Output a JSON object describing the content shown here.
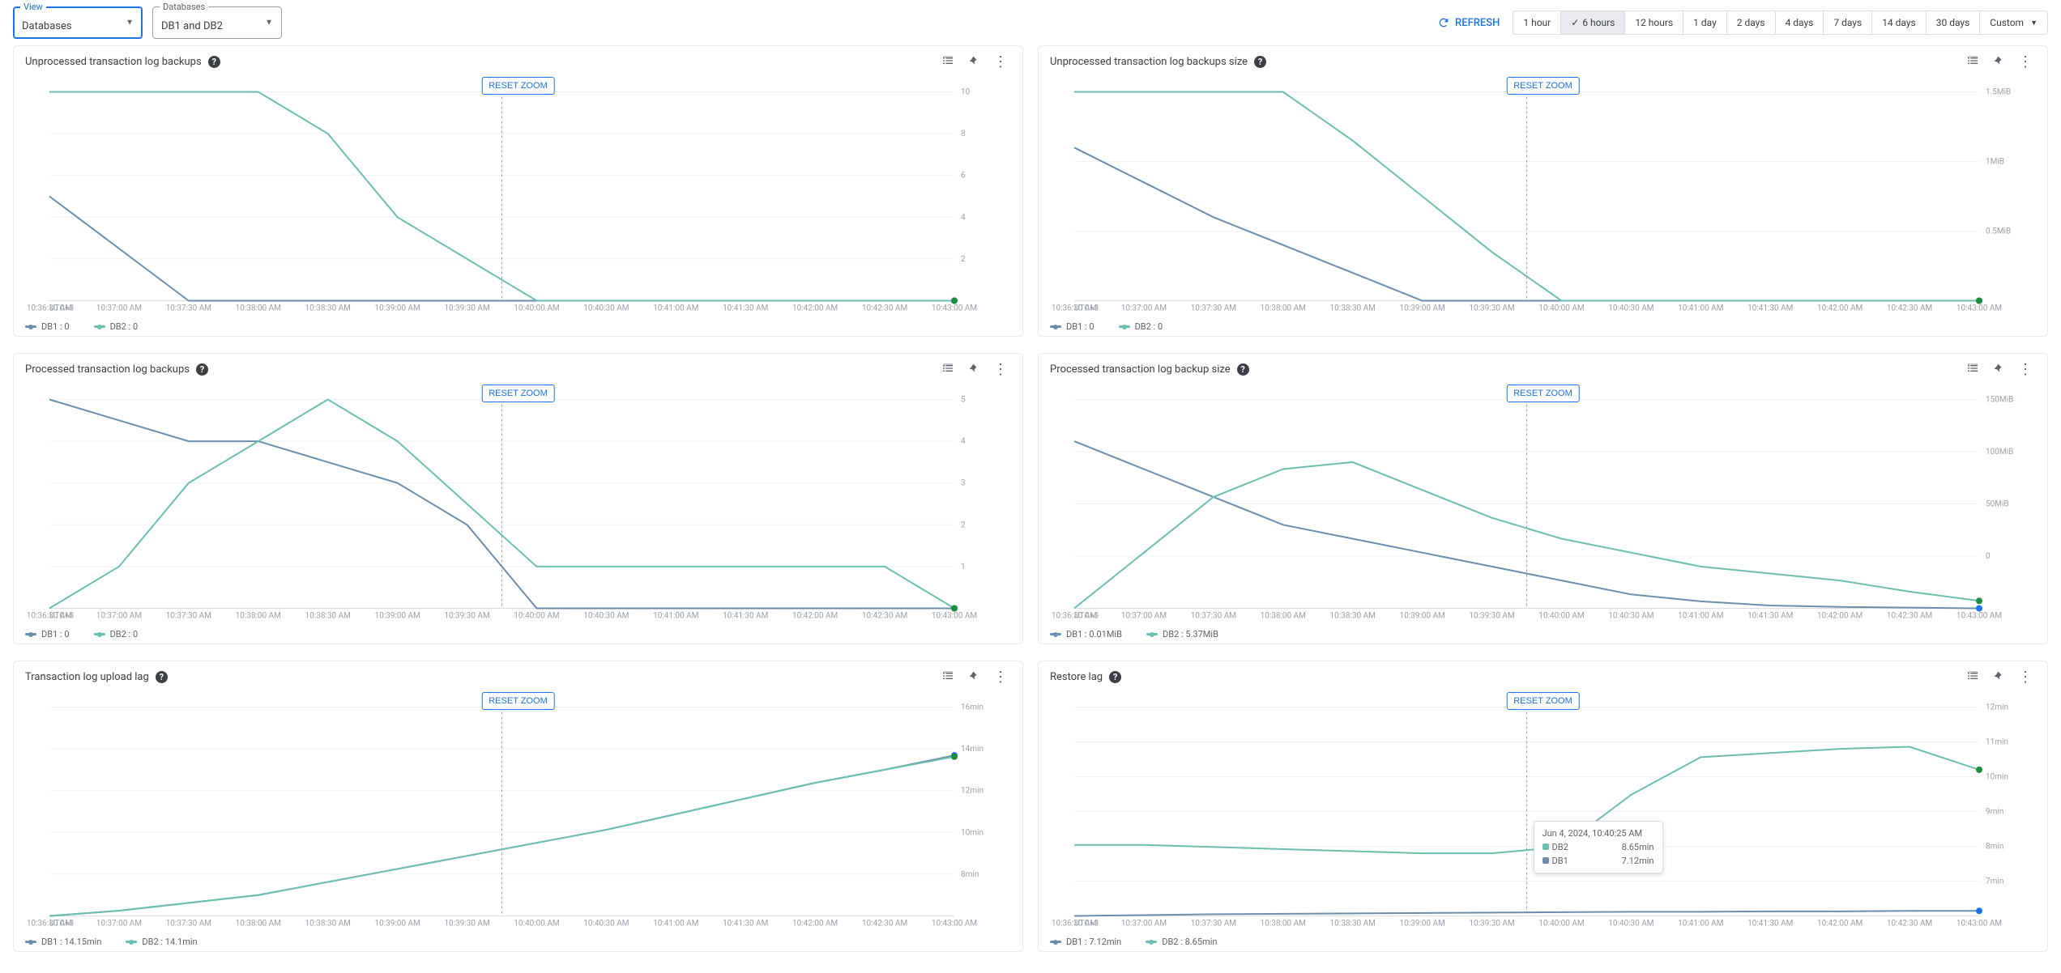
{
  "view_selector": {
    "label": "View",
    "value": "Databases"
  },
  "db_selector": {
    "label": "Databases",
    "value": "DB1 and DB2"
  },
  "refresh_label": "REFRESH",
  "time_ranges": [
    "1 hour",
    "6 hours",
    "12 hours",
    "1 day",
    "2 days",
    "4 days",
    "7 days",
    "14 days",
    "30 days",
    "Custom"
  ],
  "time_range_selected": "6 hours",
  "reset_zoom_label": "RESET ZOOM",
  "x_tick_tz": "UTC+3",
  "x_ticks": [
    "10:36:30 AM",
    "10:37:00 AM",
    "10:37:30 AM",
    "10:38:00 AM",
    "10:38:30 AM",
    "10:39:00 AM",
    "10:39:30 AM",
    "10:40:00 AM",
    "10:40:30 AM",
    "10:41:00 AM",
    "10:41:30 AM",
    "10:42:00 AM",
    "10:42:30 AM",
    "10:43:00 AM"
  ],
  "cards": [
    {
      "title": "Unprocessed transaction log backups",
      "legend": [
        {
          "name": "DB1",
          "value": "0"
        },
        {
          "name": "DB2",
          "value": "0"
        }
      ],
      "y_labels": [
        "10",
        "8",
        "6",
        "4",
        "2"
      ]
    },
    {
      "title": "Unprocessed transaction log backups size",
      "legend": [
        {
          "name": "DB1",
          "value": "0"
        },
        {
          "name": "DB2",
          "value": "0"
        }
      ],
      "y_labels": [
        "1.5MiB",
        "1MiB",
        "0.5MiB"
      ]
    },
    {
      "title": "Processed transaction log backups",
      "legend": [
        {
          "name": "DB1",
          "value": "0"
        },
        {
          "name": "DB2",
          "value": "0"
        }
      ],
      "y_labels": [
        "5",
        "4",
        "3",
        "2",
        "1"
      ]
    },
    {
      "title": "Processed transaction log backup size",
      "legend": [
        {
          "name": "DB1",
          "value": "0.01MiB"
        },
        {
          "name": "DB2",
          "value": "5.37MiB"
        }
      ],
      "y_labels": [
        "150MiB",
        "100MiB",
        "50MiB",
        "0"
      ]
    },
    {
      "title": "Transaction log upload lag",
      "legend": [
        {
          "name": "DB1",
          "value": "14.15min"
        },
        {
          "name": "DB2",
          "value": "14.1min"
        }
      ],
      "y_labels": [
        "16min",
        "14min",
        "12min",
        "10min",
        "8min"
      ]
    },
    {
      "title": "Restore lag",
      "legend": [
        {
          "name": "DB1",
          "value": "7.12min"
        },
        {
          "name": "DB2",
          "value": "8.65min"
        }
      ],
      "y_labels": [
        "12min",
        "11min",
        "10min",
        "9min",
        "8min",
        "7min"
      ]
    }
  ],
  "tooltip": {
    "timestamp": "Jun 4, 2024, 10:40:25 AM",
    "rows": [
      {
        "series": "DB2",
        "value": "8.65min"
      },
      {
        "series": "DB1",
        "value": "7.12min"
      }
    ]
  },
  "chart_data": [
    {
      "title": "Unprocessed transaction log backups",
      "type": "line",
      "x": [
        "10:36:30",
        "10:37:00",
        "10:37:30",
        "10:38:00",
        "10:38:30",
        "10:39:00",
        "10:39:30",
        "10:40:00",
        "10:40:30",
        "10:41:00",
        "10:41:30",
        "10:42:00",
        "10:42:30",
        "10:43:00"
      ],
      "series": [
        {
          "name": "DB1",
          "values": [
            5,
            2.5,
            0,
            0,
            0,
            0,
            0,
            0,
            0,
            0,
            0,
            0,
            0,
            0
          ]
        },
        {
          "name": "DB2",
          "values": [
            10,
            10,
            10,
            10,
            8,
            4,
            2,
            0,
            0,
            0,
            0,
            0,
            0,
            0
          ]
        }
      ],
      "ylim": [
        0,
        10
      ],
      "xlabel": "UTC+3",
      "ylabel": ""
    },
    {
      "title": "Unprocessed transaction log backups size",
      "type": "line",
      "x": [
        "10:36:30",
        "10:37:00",
        "10:37:30",
        "10:38:00",
        "10:38:30",
        "10:39:00",
        "10:39:30",
        "10:40:00",
        "10:40:30",
        "10:41:00",
        "10:41:30",
        "10:42:00",
        "10:42:30",
        "10:43:00"
      ],
      "series": [
        {
          "name": "DB1",
          "values": [
            1.1,
            0.85,
            0.6,
            0.4,
            0.2,
            0,
            0,
            0,
            0,
            0,
            0,
            0,
            0,
            0
          ]
        },
        {
          "name": "DB2",
          "values": [
            1.5,
            1.5,
            1.5,
            1.5,
            1.15,
            0.75,
            0.35,
            0,
            0,
            0,
            0,
            0,
            0,
            0
          ]
        }
      ],
      "ylim": [
        0,
        1.5
      ],
      "xlabel": "UTC+3",
      "ylabel": "MiB"
    },
    {
      "title": "Processed transaction log backups",
      "type": "line",
      "x": [
        "10:36:30",
        "10:37:00",
        "10:37:30",
        "10:38:00",
        "10:38:30",
        "10:39:00",
        "10:39:30",
        "10:40:00",
        "10:40:30",
        "10:41:00",
        "10:41:30",
        "10:42:00",
        "10:42:30",
        "10:43:00"
      ],
      "series": [
        {
          "name": "DB1",
          "values": [
            5,
            4.5,
            4,
            4,
            3.5,
            3,
            2,
            0,
            0,
            0,
            0,
            0,
            0,
            0
          ]
        },
        {
          "name": "DB2",
          "values": [
            0,
            1,
            3,
            4,
            5,
            4,
            2.5,
            1,
            1,
            1,
            1,
            1,
            1,
            0
          ]
        }
      ],
      "ylim": [
        0,
        5
      ],
      "xlabel": "UTC+3",
      "ylabel": ""
    },
    {
      "title": "Processed transaction log backup size",
      "type": "line",
      "x": [
        "10:36:30",
        "10:37:00",
        "10:37:30",
        "10:38:00",
        "10:38:30",
        "10:39:00",
        "10:39:30",
        "10:40:00",
        "10:40:30",
        "10:41:00",
        "10:41:30",
        "10:42:00",
        "10:42:30",
        "10:43:00"
      ],
      "series": [
        {
          "name": "DB1",
          "values": [
            120,
            100,
            80,
            60,
            50,
            40,
            30,
            20,
            10,
            5,
            2,
            1,
            0.5,
            0.01
          ]
        },
        {
          "name": "DB2",
          "values": [
            0,
            40,
            80,
            100,
            105,
            85,
            65,
            50,
            40,
            30,
            25,
            20,
            12,
            5.37
          ]
        }
      ],
      "ylim": [
        0,
        150
      ],
      "xlabel": "UTC+3",
      "ylabel": "MiB"
    },
    {
      "title": "Transaction log upload lag",
      "type": "line",
      "x": [
        "10:36:30",
        "10:37:00",
        "10:37:30",
        "10:38:00",
        "10:38:30",
        "10:39:00",
        "10:39:30",
        "10:40:00",
        "10:40:30",
        "10:41:00",
        "10:41:30",
        "10:42:00",
        "10:42:30",
        "10:43:00"
      ],
      "series": [
        {
          "name": "DB1",
          "values": [
            8,
            8.2,
            8.5,
            8.8,
            9.3,
            9.8,
            10.3,
            10.8,
            11.3,
            11.9,
            12.5,
            13.1,
            13.6,
            14.15
          ]
        },
        {
          "name": "DB2",
          "values": [
            8,
            8.2,
            8.5,
            8.8,
            9.3,
            9.8,
            10.3,
            10.8,
            11.3,
            11.9,
            12.5,
            13.1,
            13.6,
            14.1
          ]
        }
      ],
      "ylim": [
        8,
        16
      ],
      "xlabel": "UTC+3",
      "ylabel": "min"
    },
    {
      "title": "Restore lag",
      "type": "line",
      "x": [
        "10:36:30",
        "10:37:00",
        "10:37:30",
        "10:38:00",
        "10:38:30",
        "10:39:00",
        "10:39:30",
        "10:40:00",
        "10:40:30",
        "10:41:00",
        "10:41:30",
        "10:42:00",
        "10:42:30",
        "10:43:00"
      ],
      "series": [
        {
          "name": "DB1",
          "values": [
            7,
            7.02,
            7.04,
            7.05,
            7.06,
            7.07,
            7.08,
            7.09,
            7.1,
            7.1,
            7.11,
            7.11,
            7.12,
            7.12
          ]
        },
        {
          "name": "DB2",
          "values": [
            8.7,
            8.7,
            8.65,
            8.6,
            8.55,
            8.5,
            8.5,
            8.65,
            9.9,
            10.8,
            10.9,
            11.0,
            11.05,
            10.5
          ]
        }
      ],
      "ylim": [
        7,
        12
      ],
      "xlabel": "UTC+3",
      "ylabel": "min"
    }
  ]
}
